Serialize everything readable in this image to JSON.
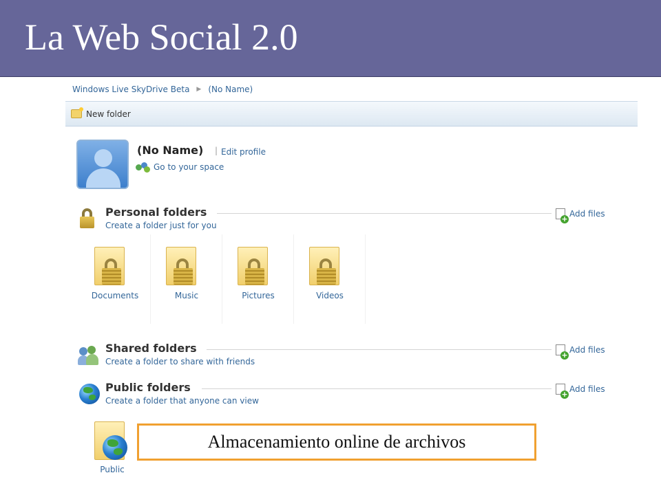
{
  "slide": {
    "title": "La Web Social 2.0"
  },
  "breadcrumb": {
    "items": [
      "Windows Live SkyDrive Beta",
      "(No Name)"
    ]
  },
  "toolbar": {
    "new_folder_label": "New folder"
  },
  "profile": {
    "name": "(No Name)",
    "separator": "|",
    "edit_label": "Edit profile",
    "space_link": "Go to your space"
  },
  "sections": {
    "personal": {
      "title": "Personal folders",
      "subtitle": "Create a folder just for you",
      "add_files": "Add files",
      "folders": [
        "Documents",
        "Music",
        "Pictures",
        "Videos"
      ]
    },
    "shared": {
      "title": "Shared folders",
      "subtitle": "Create a folder to share with friends",
      "add_files": "Add files"
    },
    "public": {
      "title": "Public folders",
      "subtitle": "Create a folder that anyone can view",
      "add_files": "Add files",
      "folders": [
        "Public"
      ]
    }
  },
  "caption": "Almacenamiento online de archivos",
  "colors": {
    "header_bg": "#666699",
    "link": "#336699",
    "caption_border": "#f0a030"
  },
  "icons": {
    "new_folder": "new-folder-icon",
    "avatar": "user-avatar",
    "space": "people-icon",
    "personal": "lock-icon",
    "shared": "shared-people-icon",
    "public": "globe-icon",
    "add_files": "add-file-icon"
  }
}
